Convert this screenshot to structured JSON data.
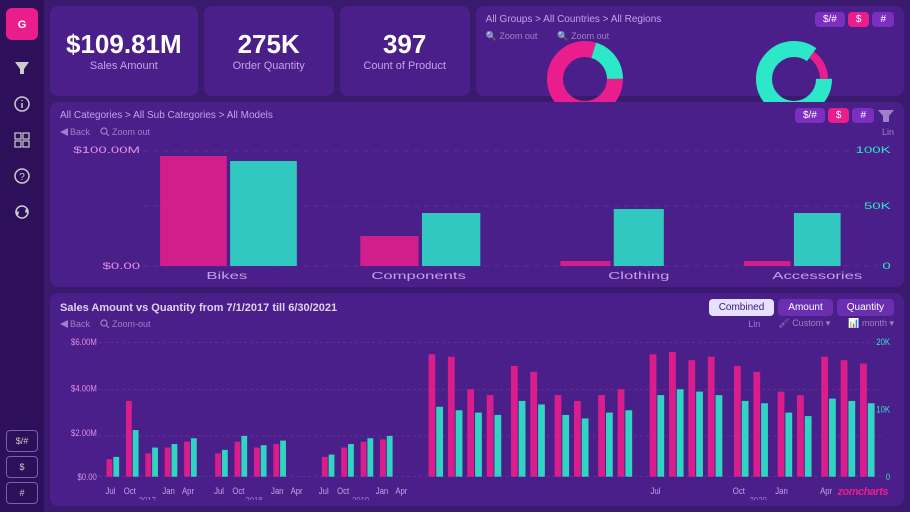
{
  "sidebar": {
    "logo": "G",
    "icons": [
      {
        "name": "filter-icon",
        "symbol": "▼",
        "active": false
      },
      {
        "name": "info-icon",
        "symbol": "i",
        "active": false
      },
      {
        "name": "layers-icon",
        "symbol": "⊞",
        "active": false
      },
      {
        "name": "help-icon",
        "symbol": "?",
        "active": false
      },
      {
        "name": "sync-icon",
        "symbol": "↺",
        "active": false
      }
    ],
    "bottom_buttons": [
      "$/# ",
      "$",
      "#"
    ]
  },
  "kpi": {
    "sales_amount": "$109.81M",
    "sales_label": "Sales Amount",
    "order_qty": "275K",
    "order_label": "Order Quantity",
    "count": "397",
    "count_label": "Count of Product"
  },
  "donut_panel": {
    "breadcrumb": "All Groups > All Countries > All Regions",
    "buttons": [
      "$/#",
      "$",
      "#"
    ],
    "zoom_out_1": "🔍 Zoom out",
    "zoom_out_2": "🔍 Zoom out"
  },
  "bar_panel": {
    "breadcrumb": "All Categories > All Sub Categories > All Models",
    "buttons": [
      "$/#",
      "$",
      "#"
    ],
    "back": "Back",
    "zoom_out": "Zoom out",
    "lin": "Lin",
    "categories": [
      "Bikes",
      "Components",
      "Clothing",
      "Accessories"
    ],
    "y_labels": [
      "$100.00M",
      "$0.00"
    ],
    "y2_labels": [
      "100K",
      "50K",
      "0"
    ]
  },
  "timeseries": {
    "title": "Sales Amount vs Quantity from  7/1/2017  till  6/30/2021",
    "buttons": [
      "Combined",
      "Amount",
      "Quantity"
    ],
    "active_button": "Combined",
    "back": "Back",
    "zoom_out": "Zoom-out",
    "lin": "Lin",
    "custom": "Custom",
    "month": "month",
    "x_labels": [
      "Jul",
      "Oct",
      "Jan",
      "Apr",
      "Jul",
      "Oct",
      "Jan",
      "Apr",
      "Jul",
      "Oct",
      "Jan",
      "Apr",
      "Jul",
      "Oct",
      "Jan",
      "Apr"
    ],
    "years": [
      "2017",
      "2018",
      "2019",
      "2020"
    ],
    "y_labels_left": [
      "$6.00M",
      "$4.00M",
      "$2.00M",
      "$0.00"
    ],
    "y_labels_right": [
      "20K",
      "10K",
      "0"
    ]
  },
  "colors": {
    "pink": "#e91e8c",
    "teal": "#2de8c8",
    "purple_dark": "#3a1a6e",
    "purple_mid": "#4a1f8a",
    "purple_light": "#7b2fbe",
    "sidebar_bg": "#2d0f5a"
  },
  "watermark": "zomcharts"
}
